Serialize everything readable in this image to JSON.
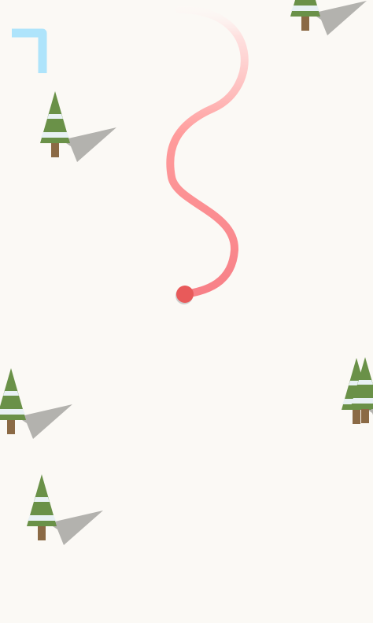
{
  "game": {
    "title": "",
    "snow_color": "#fbf9f5",
    "player": {
      "icon": "red-ball-skier",
      "color": "#e85a5a"
    },
    "trail": {
      "icon": "ski-trail",
      "color": "#ff8a8a"
    },
    "pause_indicator": {
      "icon": "corner-bracket-icon",
      "color": "#aee4fb"
    },
    "tree_style": {
      "icon": "pine-tree-icon",
      "foliage_color": "#6a9148",
      "snow_band_color": "#e8f1f4",
      "trunk_color": "#8b6a45",
      "shadow_color": "#b3b2ae"
    }
  }
}
